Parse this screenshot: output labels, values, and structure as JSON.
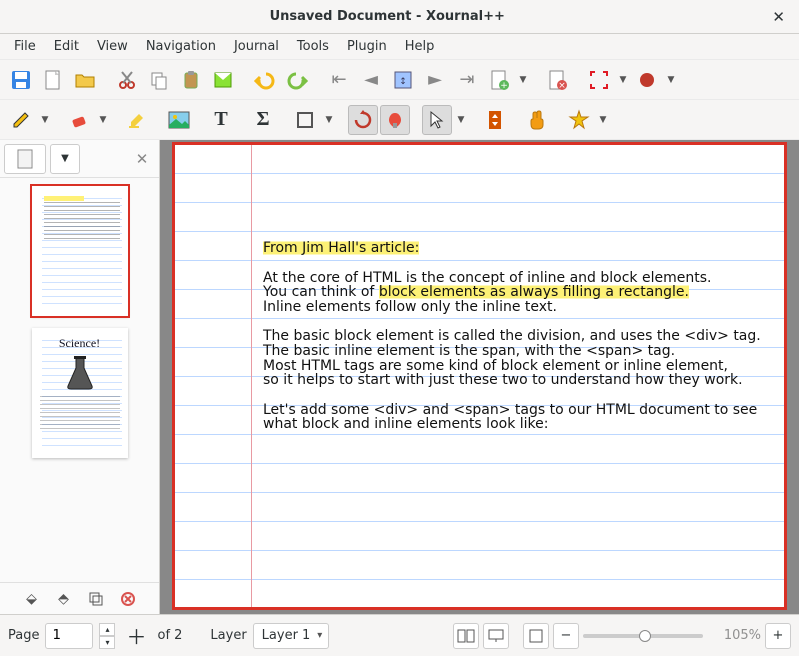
{
  "window": {
    "title": "Unsaved Document - Xournal++"
  },
  "menus": [
    "File",
    "Edit",
    "View",
    "Navigation",
    "Journal",
    "Tools",
    "Plugin",
    "Help"
  ],
  "status": {
    "page_label": "Page",
    "page_current": "1",
    "page_total": "of 2",
    "layer_label": "Layer",
    "layer_selected": "Layer 1",
    "zoom_pct": "105%"
  },
  "thumb2": {
    "label": "Science!"
  },
  "doc": {
    "heading": "From Jim Hall's article:",
    "lines": [
      "At the core of HTML is the concept of inline and block elements.",
      "You can think of ",
      "block elements as always filling a rectangle.",
      "Inline elements follow only the inline text.",
      "The basic block element is called the division, and uses the <div> tag.",
      "The basic inline element is the span, with the <span> tag.",
      "Most HTML tags are some kind of block element or inline element,",
      "so it helps to start with just these two to understand how they work.",
      "Let's add some <div> and <span> tags to our HTML document to see",
      "what block and inline elements look like:"
    ]
  }
}
